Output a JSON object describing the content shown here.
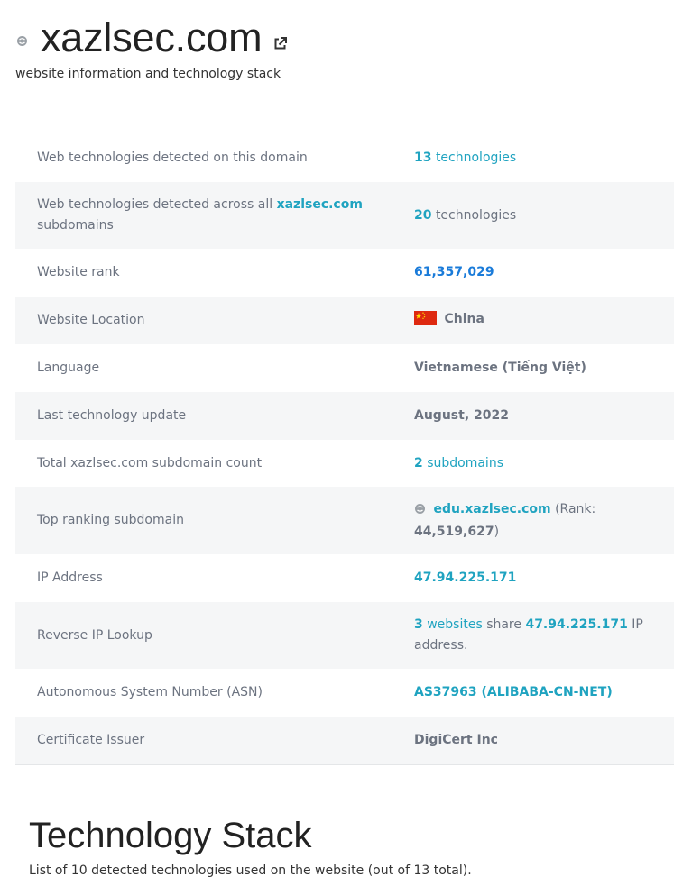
{
  "header": {
    "title": "xazlsec.com",
    "subtitle": "website information and technology stack",
    "favicon_icon": "site-favicon-icon",
    "external_link_icon": "external-link-icon"
  },
  "rows": {
    "tech_domain": {
      "label": "Web technologies detected on this domain",
      "count": "13",
      "unit": "technologies"
    },
    "tech_sub": {
      "label_pre": "Web technologies detected across all",
      "domain": "xazlsec.com",
      "label_post": "subdomains",
      "count": "20",
      "unit": "technologies"
    },
    "rank": {
      "label": "Website rank",
      "value": "61,357,029"
    },
    "location": {
      "label": "Website Location",
      "value": "China",
      "flag_icon": "china-flag-icon"
    },
    "language": {
      "label": "Language",
      "value": "Vietnamese (Tiếng Việt)"
    },
    "last_update": {
      "label": "Last technology update",
      "value": "August, 2022"
    },
    "sub_count": {
      "label": "Total xazlsec.com subdomain count",
      "count": "2",
      "unit": "subdomains"
    },
    "top_sub": {
      "label": "Top ranking subdomain",
      "domain": "edu.xazlsec.com",
      "rank_pre": "(Rank:",
      "rank": "44,519,627",
      "rank_post": ")"
    },
    "ip": {
      "label": "IP Address",
      "value": "47.94.225.171"
    },
    "reverse_ip": {
      "label": "Reverse IP Lookup",
      "count": "3",
      "websites": "websites",
      "share": "share",
      "ip": "47.94.225.171",
      "post": "IP address."
    },
    "asn": {
      "label": "Autonomous System Number (ASN)",
      "value": "AS37963 (ALIBABA-CN-NET)"
    },
    "cert": {
      "label": "Certificate Issuer",
      "value": "DigiCert Inc"
    }
  },
  "stack": {
    "title": "Technology Stack",
    "subtitle": "List of 10 detected technologies used on the website (out of 13 total)."
  },
  "colors": {
    "link_teal": "#1fa3c0",
    "link_blue": "#1a7bd9",
    "label_gray": "#6c7380",
    "stripe": "#f5f6f7"
  }
}
